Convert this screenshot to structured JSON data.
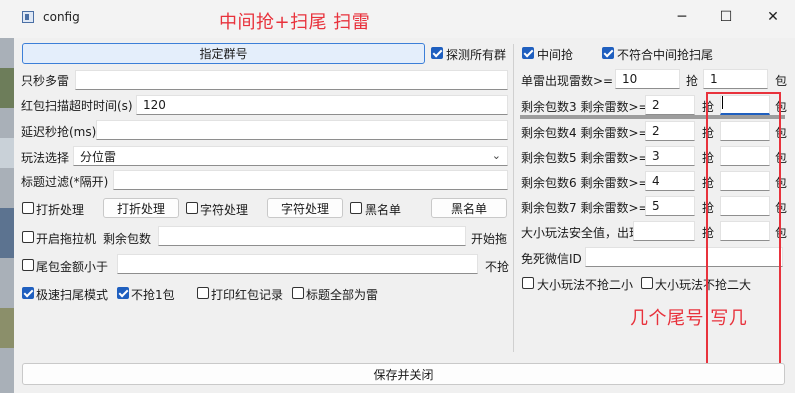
{
  "window": {
    "title": "config",
    "annotation_title": "中间抢+扫尾 扫雷",
    "minimize_glyph": "─",
    "maximize_glyph": "☐",
    "close_glyph": "✕"
  },
  "left_panel": {
    "group_button": "指定群号",
    "detect_all_groups": {
      "label": "探测所有群",
      "checked": true
    },
    "only_sec_mine_label": "只秒多雷",
    "only_sec_mine_value": "",
    "scan_timeout_label": "红包扫描超时时间(s)",
    "scan_timeout_value": "120",
    "delay_label": "延迟秒抢(ms)",
    "delay_value": "",
    "play_mode_label": "玩法选择",
    "play_mode_value": "分位雷",
    "title_filter_label": "标题过滤(*隔开)",
    "title_filter_value": "",
    "discount": {
      "label": "打折处理",
      "checked": false,
      "button": "打折处理"
    },
    "char_proc": {
      "label": "字符处理",
      "checked": false,
      "button": "字符处理"
    },
    "blacklist": {
      "label": "黑名单",
      "checked": false,
      "button": "黑名单"
    },
    "tractor": {
      "label": "开启拖拉机",
      "checked": false,
      "remain_label": "剩余包数",
      "remain_value": "",
      "start_label": "开始拖"
    },
    "tail_amount": {
      "label": "尾包金额小于",
      "checked": false,
      "value": "",
      "suffix": "不抢"
    },
    "fast_tail": {
      "label": "极速扫尾模式",
      "checked": true
    },
    "no_grab_one": {
      "label": "不抢1包",
      "checked": true
    },
    "print_log": {
      "label": "打印红包记录",
      "checked": false
    },
    "title_all_mine": {
      "label": "标题全部为雷",
      "checked": false
    }
  },
  "right_panel": {
    "middle_grab": {
      "label": "中间抢",
      "checked": true
    },
    "not_fit_middle": {
      "label": "不符合中间抢扫尾",
      "checked": true
    },
    "rows": [
      {
        "label": "单雷出现雷数>=",
        "v1": "10",
        "mid": "抢",
        "v2": "1",
        "suffix": "包"
      },
      {
        "label": "剩余包数3 剩余雷数>=",
        "v1": "2",
        "mid": "抢",
        "v2": "",
        "suffix": "包"
      },
      {
        "label": "剩余包数4 剩余雷数>=",
        "v1": "2",
        "mid": "抢",
        "v2": "",
        "suffix": "包"
      },
      {
        "label": "剩余包数5 剩余雷数>=",
        "v1": "3",
        "mid": "抢",
        "v2": "",
        "suffix": "包"
      },
      {
        "label": "剩余包数6 剩余雷数>=",
        "v1": "4",
        "mid": "抢",
        "v2": "",
        "suffix": "包"
      },
      {
        "label": "剩余包数7 剩余雷数>=",
        "v1": "5",
        "mid": "抢",
        "v2": "",
        "suffix": "包"
      },
      {
        "label": "大小玩法安全值，出现",
        "v1": "",
        "mid": "抢",
        "v2": "",
        "suffix": "包"
      }
    ],
    "free_wechat_label": "免死微信ID",
    "free_wechat_value": "",
    "size_no_two_small": {
      "label": "大小玩法不抢二小",
      "checked": false
    },
    "size_no_two_big": {
      "label": "大小玩法不抢二大",
      "checked": false
    },
    "annotation_note": "几个尾号  写几"
  },
  "save_button": "保存并关闭",
  "colors": {
    "annotation": "#e8323c",
    "accent": "#1f5fbf",
    "background": "#f0f0f0"
  },
  "icons": [
    "config-app-icon",
    "minimize-icon",
    "maximize-icon",
    "close-icon",
    "chevron-down-icon"
  ]
}
